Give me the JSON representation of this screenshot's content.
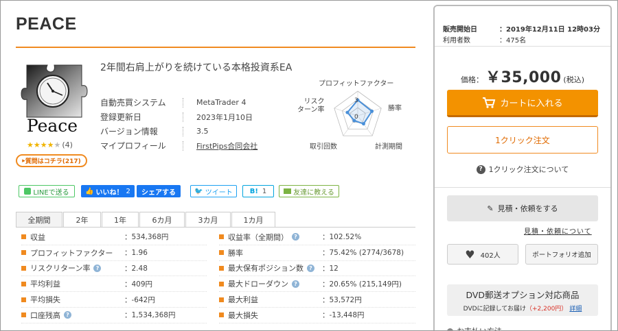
{
  "product": {
    "title": "PEACE",
    "logo_text": "Peace",
    "rating_count": "(4)",
    "question_button": "質問はコチラ(217)",
    "description": "2年間右肩上がりを続けている本格投資系EA",
    "info": [
      {
        "label": "自動売買システム",
        "value": "MetaTrader 4"
      },
      {
        "label": "登録更新日",
        "value": "2023年1月10日"
      },
      {
        "label": "バージョン情報",
        "value": "3.5"
      },
      {
        "label": "マイプロフィール",
        "value": "FirstPips合同会社"
      }
    ]
  },
  "radar": {
    "labels": [
      "プロフィットファクター",
      "勝率",
      "計測期間",
      "取引回数",
      "リスク\nターン率"
    ],
    "label_line1": "リスク",
    "label_line2": "ターン率",
    "ticks": [
      "3",
      "0"
    ],
    "values": [
      3.2,
      3.0,
      2.0,
      1.2,
      2.2
    ],
    "max": 5
  },
  "social": {
    "line": "LINEで送る",
    "fb_like": "いいね！",
    "fb_count": "2",
    "share": "シェアする",
    "tweet": "ツイート",
    "hatena": "B!",
    "hatena_count": "1",
    "friend": "友達に教える"
  },
  "tabs": [
    "全期間",
    "2年",
    "1年",
    "6カ月",
    "3カ月",
    "1カ月"
  ],
  "stats_left": [
    {
      "label": "収益",
      "value": "：534,368円",
      "help": false
    },
    {
      "label": "プロフィットファクター",
      "value": "：1.96",
      "help": false
    },
    {
      "label": "リスクリターン率",
      "value": "：2.48",
      "help": true
    },
    {
      "label": "平均利益",
      "value": "：409円",
      "help": false
    },
    {
      "label": "平均損失",
      "value": "：-642円",
      "help": false
    },
    {
      "label": "口座残高",
      "value": "：1,534,368円",
      "help": true
    }
  ],
  "stats_right": [
    {
      "label": "収益率（全期間）",
      "value": "：102.52%",
      "help": true
    },
    {
      "label": "勝率",
      "value": "：75.42% (2774/3678)",
      "help": false
    },
    {
      "label": "最大保有ポジション数",
      "value": "：12",
      "help": true
    },
    {
      "label": "最大ドローダウン",
      "value": "：20.65% (215,149円)",
      "help": true
    },
    {
      "label": "最大利益",
      "value": "：53,572円",
      "help": false
    },
    {
      "label": "最大損失",
      "value": "：-13,448円",
      "help": false
    }
  ],
  "panel": {
    "sale_label": "販売開始日",
    "sale_value": "：2019年12月11日 12時03分",
    "users_label": "利用者数",
    "users_value": "：475名",
    "price_label": "価格：",
    "price": "￥35,000",
    "tax": "(税込)",
    "cart": "カートに入れる",
    "oneclick": "1クリック注文",
    "oneclick_about": "1クリック注文について",
    "quote": "見積・依頼をする",
    "quote_link": "見積・依頼について",
    "fav_count": "402人",
    "portfolio": "ポートフォリオ追加",
    "dvd_title": "DVD郵送オプション対応商品",
    "dvd_text": "DVDに記録してお届け",
    "dvd_price": "（+2,200円）",
    "dvd_link": "詳細",
    "cutoff": "お支払い方法"
  },
  "colors": {
    "accent": "#f08a1f",
    "cart": "#f39200",
    "facebook": "#1877f2",
    "line": "#4cc764",
    "radar": "#4a90d9"
  }
}
